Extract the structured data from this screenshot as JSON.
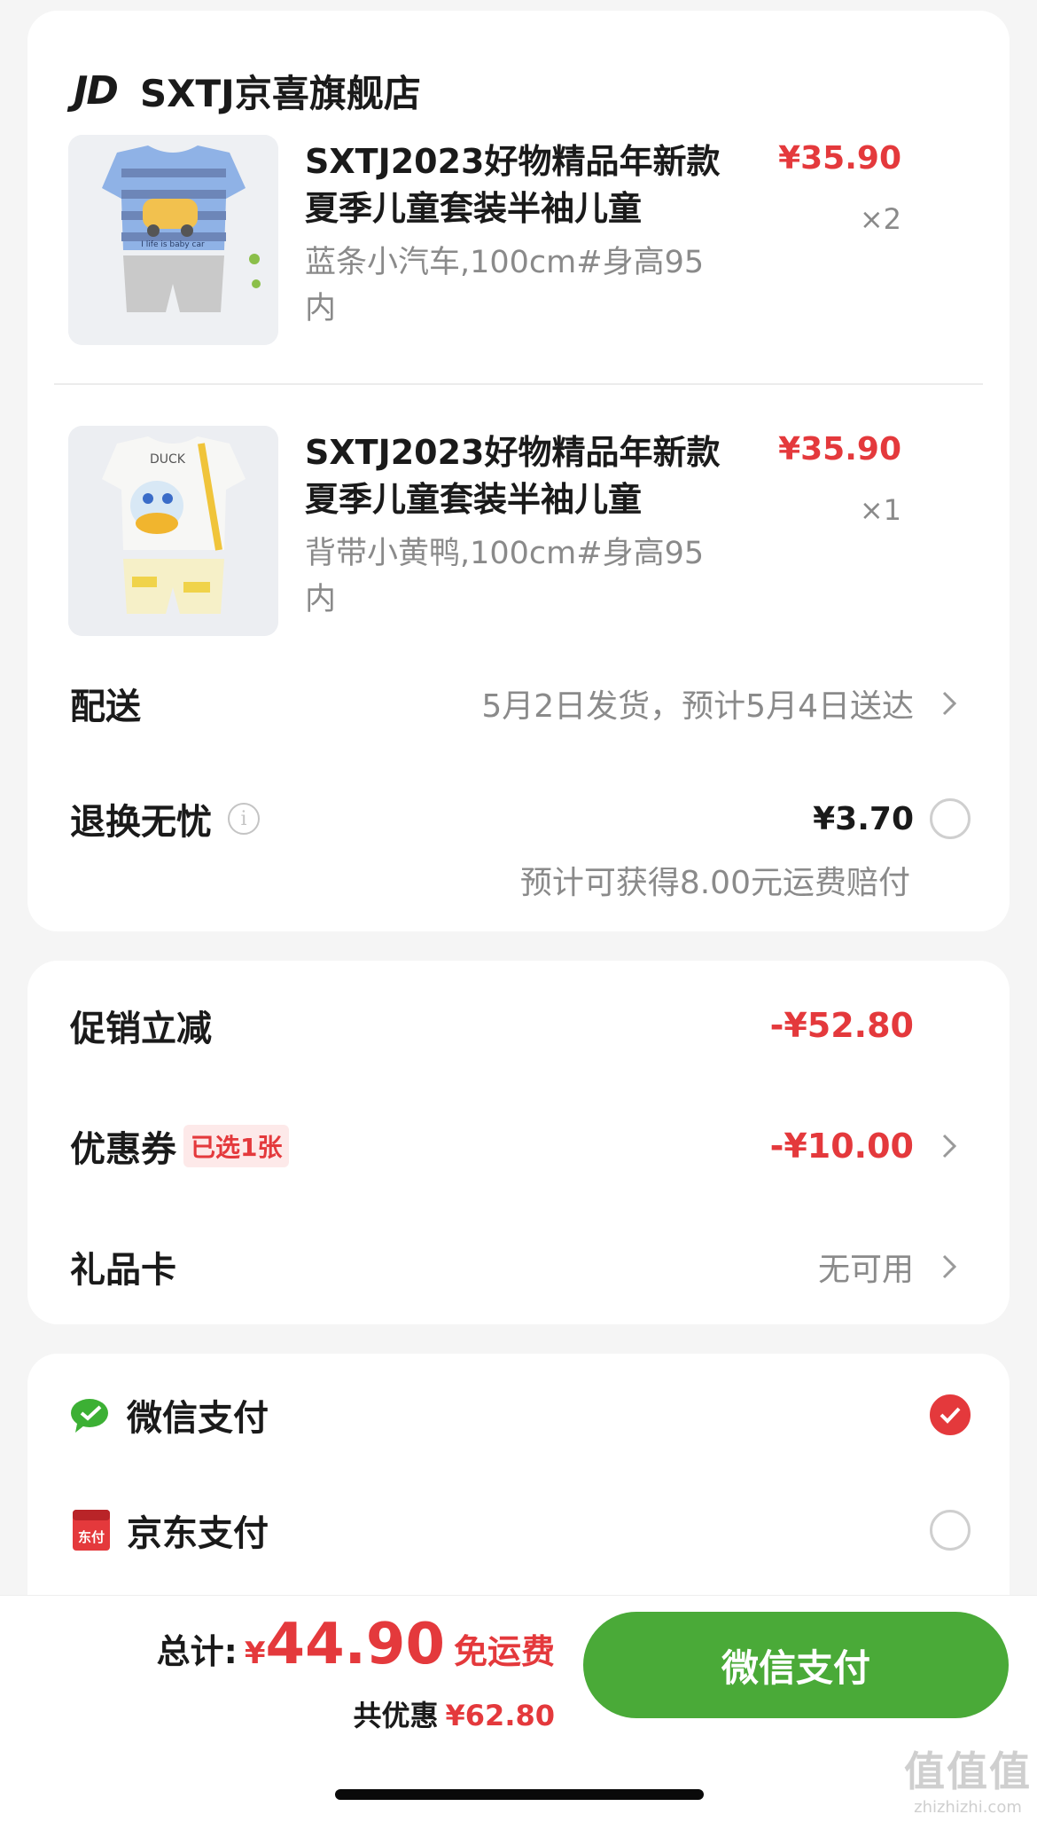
{
  "store": {
    "logo": "JD",
    "name": "SXTJ京喜旗舰店"
  },
  "products": [
    {
      "title": "SXTJ2023好物精品年新款夏季儿童套装半袖儿童",
      "spec": "蓝条小汽车,100cm#身高95内",
      "price": "¥35.90",
      "qty": "×2",
      "image_print": "I life is baby car"
    },
    {
      "title": "SXTJ2023好物精品年新款夏季儿童套装半袖儿童",
      "spec": "背带小黄鸭,100cm#身高95内",
      "price": "¥35.90",
      "qty": "×1",
      "image_print": "DUCK"
    }
  ],
  "delivery": {
    "label": "配送",
    "value": "5月2日发货，预计5月4日送达"
  },
  "return_insurance": {
    "label": "退换无忧",
    "price": "¥3.70",
    "note": "预计可获得8.00元运费赔付",
    "selected": false
  },
  "discounts": {
    "promo": {
      "label": "促销立减",
      "value": "-¥52.80"
    },
    "coupon": {
      "label": "优惠券",
      "tag": "已选1张",
      "value": "-¥10.00"
    },
    "gift_card": {
      "label": "礼品卡",
      "value": "无可用"
    }
  },
  "payment_methods": [
    {
      "label": "微信支付",
      "icon": "wechat-pay-icon",
      "selected": true
    },
    {
      "label": "京东支付",
      "icon": "jd-pay-icon",
      "icon_text": "东付",
      "selected": false
    }
  ],
  "summary": {
    "total_label": "总计:",
    "currency": "¥",
    "total": "44.90",
    "shipping": "免运费",
    "saved_label": "共优惠",
    "saved": "¥62.80"
  },
  "pay_button": "微信支付",
  "watermark": {
    "logo": "值值值",
    "url": "zhizhizhi.com"
  },
  "colors": {
    "accent_red": "#e4393c",
    "wechat_green": "#4aaa38",
    "background": "#f5f5f5"
  }
}
